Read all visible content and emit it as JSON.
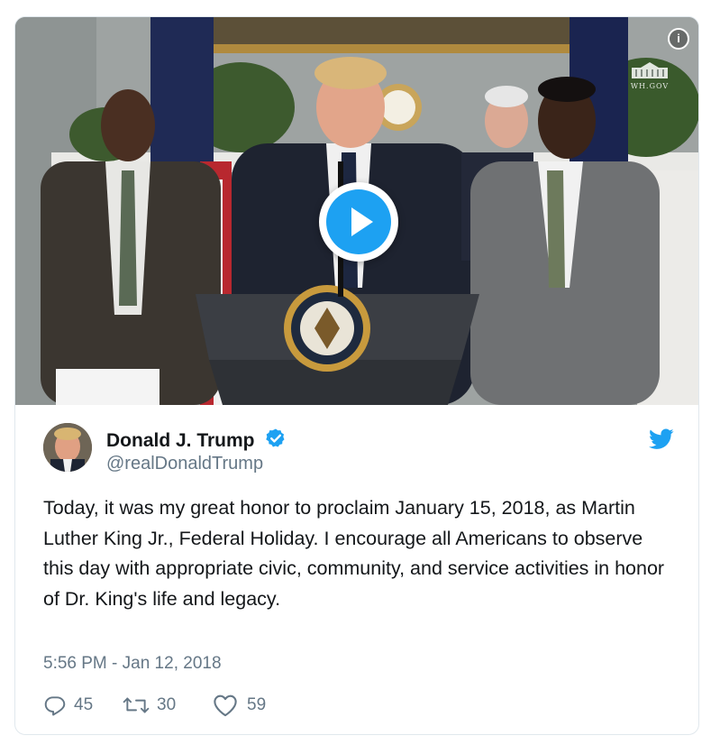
{
  "media": {
    "info_label": "i",
    "watermark_label": "WH.GOV",
    "seal_text": "SEAL OF THE PRESIDENT OF THE UNITED STATES"
  },
  "author": {
    "display_name": "Donald J. Trump",
    "handle": "@realDonaldTrump",
    "verified": true
  },
  "tweet": {
    "text": "Today, it was my great honor to proclaim January 15, 2018, as Martin Luther King Jr., Federal Holiday. I encourage all Americans to observe this day with appropriate civic, community, and service activities in honor of Dr. King's life and legacy.",
    "timestamp": "5:56 PM - Jan 12, 2018"
  },
  "actions": {
    "replies": "45",
    "retweets": "30",
    "likes": "59"
  },
  "colors": {
    "twitter_blue": "#1da1f2",
    "text_primary": "#14171a",
    "text_secondary": "#657786",
    "border": "#e1e8ed"
  }
}
